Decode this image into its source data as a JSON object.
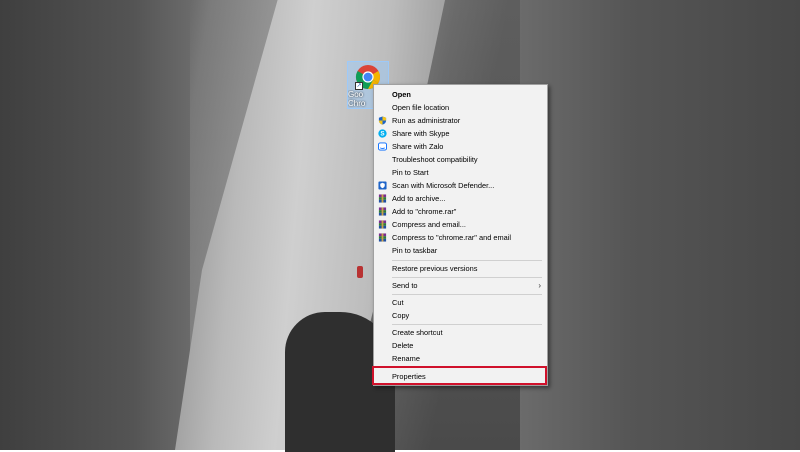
{
  "desktop_icon": {
    "label": "Goo\nChro",
    "icon": "chrome-icon"
  },
  "context_menu": {
    "items": [
      {
        "label": "Open",
        "bold": true,
        "icon": null
      },
      {
        "label": "Open file location",
        "icon": null
      },
      {
        "label": "Run as administrator",
        "icon": "shield-icon"
      },
      {
        "label": "Share with Skype",
        "icon": "skype-icon"
      },
      {
        "label": "Share with Zalo",
        "icon": "zalo-icon"
      },
      {
        "label": "Troubleshoot compatibility",
        "icon": null
      },
      {
        "label": "Pin to Start",
        "icon": null
      },
      {
        "label": "Scan with Microsoft Defender...",
        "icon": "defender-icon"
      },
      {
        "label": "Add to archive...",
        "icon": "winrar-icon"
      },
      {
        "label": "Add to \"chrome.rar\"",
        "icon": "winrar-icon"
      },
      {
        "label": "Compress and email...",
        "icon": "winrar-icon"
      },
      {
        "label": "Compress to \"chrome.rar\" and email",
        "icon": "winrar-icon"
      },
      {
        "label": "Pin to taskbar",
        "icon": null
      },
      {
        "label": "Restore previous versions",
        "icon": null
      },
      {
        "label": "Send to",
        "icon": null,
        "submenu": true
      },
      {
        "label": "Cut",
        "icon": null
      },
      {
        "label": "Copy",
        "icon": null
      },
      {
        "label": "Create shortcut",
        "icon": null
      },
      {
        "label": "Delete",
        "icon": null
      },
      {
        "label": "Rename",
        "icon": null
      },
      {
        "label": "Properties",
        "icon": null,
        "highlighted": true
      }
    ],
    "submenu_arrow": "›"
  },
  "colors": {
    "highlight_border": "#d0112b",
    "menu_background": "#f2f2f2"
  }
}
